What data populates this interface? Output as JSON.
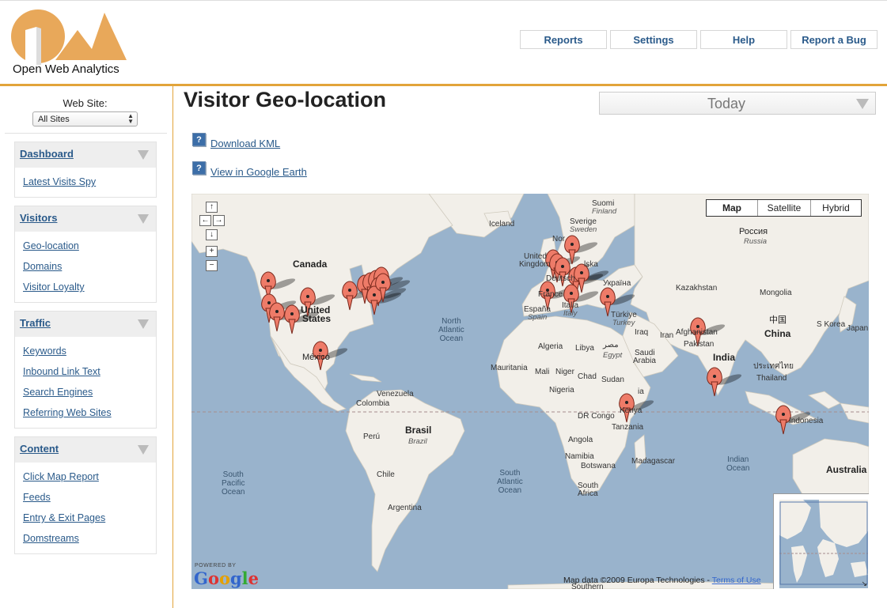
{
  "brand": {
    "logo_text": "Open Web Analytics"
  },
  "topnav": [
    "Reports",
    "Settings",
    "Help",
    "Report a Bug"
  ],
  "sidebar": {
    "website_label": "Web Site:",
    "site_selected": "All Sites",
    "groups": [
      {
        "title": "Dashboard",
        "items": [
          "Latest Visits Spy"
        ]
      },
      {
        "title": "Visitors",
        "items": [
          "Geo-location",
          "Domains",
          "Visitor Loyalty"
        ]
      },
      {
        "title": "Traffic",
        "items": [
          "Keywords",
          "Inbound Link Text",
          "Search Engines",
          "Referring Web Sites"
        ]
      },
      {
        "title": "Content",
        "items": [
          "Click Map Report",
          "Feeds",
          "Entry & Exit Pages",
          "Domstreams"
        ]
      }
    ]
  },
  "main": {
    "title": "Visitor Geo-location",
    "period": "Today",
    "links": {
      "kml": "Download KML",
      "google_earth": "View in Google Earth"
    },
    "help_icon": "?"
  },
  "map": {
    "types": [
      "Map",
      "Satellite",
      "Hybrid"
    ],
    "controls": [
      "↑",
      "←",
      "→",
      "↓",
      "+",
      "−"
    ],
    "copyright": "Map data ©2009 Europa Technologies -",
    "terms": "Terms of Use",
    "powered_by": "POWERED BY",
    "google": "Google",
    "labels": {
      "canada": "Canada",
      "us1": "United",
      "us2": "States",
      "mexico": "México",
      "iceland": "Iceland",
      "suomi": "Suomi",
      "finland": "Finland",
      "sverige": "Sverige",
      "sweden": "Sweden",
      "norge": "Nor",
      "uk1": "United",
      "uk2": "Kingdom",
      "deutsch": "Deutsch",
      "polska": "lska",
      "france": "France",
      "espana": "España",
      "spain": "Spain",
      "italia": "Italia",
      "italy": "Italy",
      "ukraina": "Україна",
      "turkiye": "Türkiye",
      "turkey": "Turkey",
      "rossiya": "Россия",
      "russia": "Russia",
      "kazakhstan": "Kazakhstan",
      "mongolia": "Mongolia",
      "china_cn": "中国",
      "china": "China",
      "skorea": "S Korea",
      "japan": "Japan",
      "afghanistan": "Afghanistan",
      "pakistan": "Pakistan",
      "iraq": "Iraq",
      "iran": "Iran",
      "saudi1": "Saudi",
      "saudi2": "Arabia",
      "misr": "مصر",
      "egypt": "Egypt",
      "india": "India",
      "thailand_th": "ประเทศไทย",
      "thailand": "Thailand",
      "indonesia": "Indonesia",
      "algeria": "Algeria",
      "libya": "Libya",
      "mauritania": "Mauritania",
      "mali": "Mali",
      "niger": "Niger",
      "chad": "Chad",
      "sudan": "Sudan",
      "nigeria": "Nigeria",
      "ethiopia": "ia",
      "drcongo": "DR Congo",
      "kenya": "Kenya",
      "tanzania": "Tanzania",
      "angola": "Angola",
      "namibia": "Namibia",
      "botswana": "Botswana",
      "madagascar": "Madagascar",
      "safrica1": "South",
      "safrica2": "Africa",
      "venezuela": "Venezuela",
      "colombia": "Colombia",
      "peru": "Perú",
      "brasil": "Brasil",
      "brazil": "Brazil",
      "chile": "Chile",
      "argentina": "Argentina",
      "nao": "North\nAtlantic\nOcean",
      "sao": "South\nAtlantic\nOcean",
      "spo": "South\nPacific\nOcean",
      "io": "Indian\nOcean",
      "australia": "Australia",
      "southern": "Southern"
    }
  }
}
